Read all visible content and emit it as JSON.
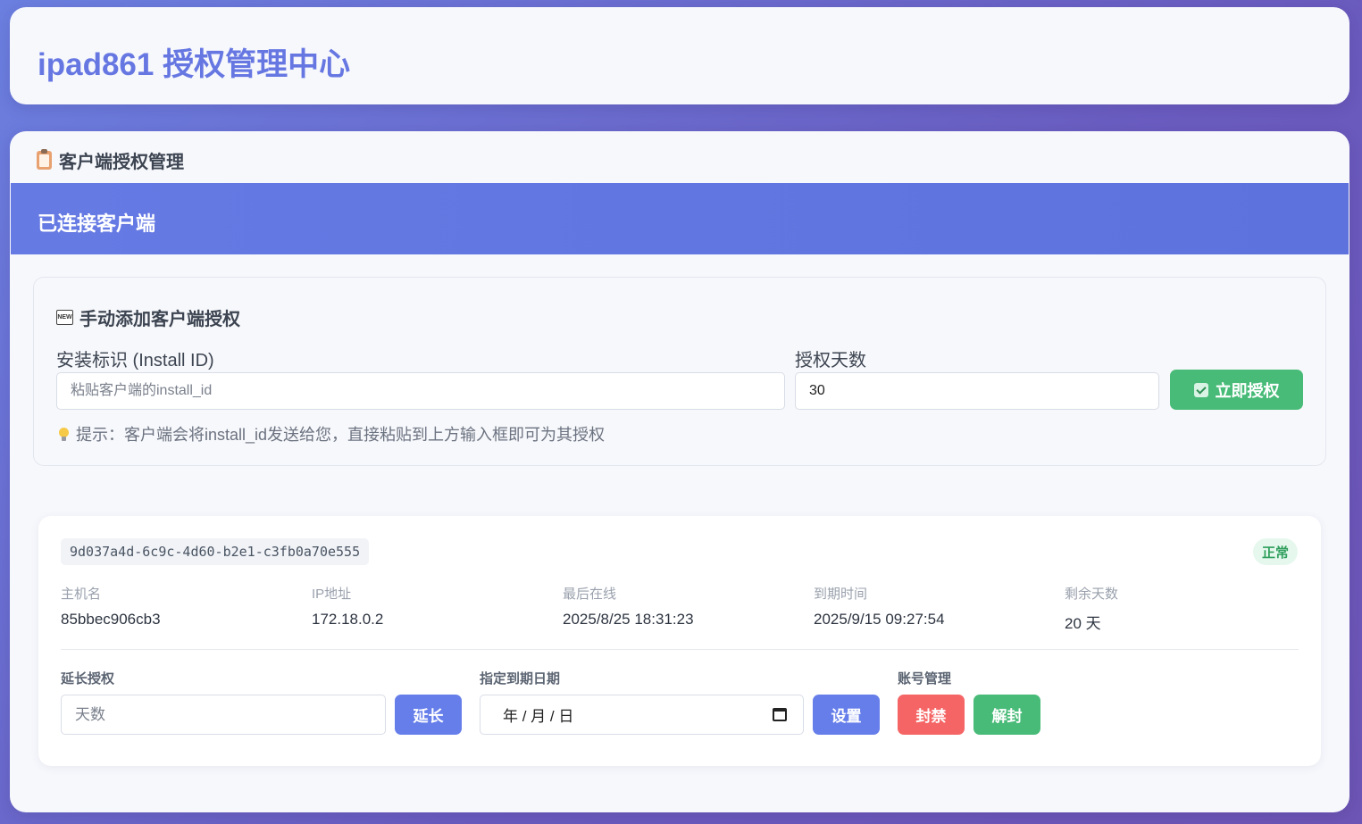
{
  "header": {
    "title": "ipad861 授权管理中心"
  },
  "section": {
    "title": "客户端授权管理",
    "icon": "clipboard-icon"
  },
  "banner": {
    "title": "已连接客户端"
  },
  "add_form": {
    "title": "手动添加客户端授权",
    "icon": "new-badge-icon",
    "install_id_label": "安装标识 (Install ID)",
    "install_id_placeholder": "粘贴客户端的install_id",
    "install_id_value": "",
    "days_label": "授权天数",
    "days_value": "30",
    "submit_label": "立即授权",
    "hint": "提示：客户端会将install_id发送给您，直接粘贴到上方输入框即可为其授权"
  },
  "client": {
    "id": "9d037a4d-6c9c-4d60-b2e1-c3fb0a70e555",
    "status": "正常",
    "fields": [
      {
        "label": "主机名",
        "value": "85bbec906cb3"
      },
      {
        "label": "IP地址",
        "value": "172.18.0.2"
      },
      {
        "label": "最后在线",
        "value": "2025/8/25 18:31:23"
      },
      {
        "label": "到期时间",
        "value": "2025/9/15 09:27:54"
      },
      {
        "label": "剩余天数",
        "value": "20 天"
      }
    ],
    "extend": {
      "label": "延长授权",
      "placeholder": "天数",
      "button": "延长"
    },
    "set_date": {
      "label": "指定到期日期",
      "display": "年 / 月 / 日",
      "button": "设置"
    },
    "account": {
      "label": "账号管理",
      "ban": "封禁",
      "unban": "解封"
    }
  },
  "colors": {
    "accent": "#667eea",
    "green": "#48bb78",
    "red": "#f56565",
    "title": "#6677e2"
  }
}
